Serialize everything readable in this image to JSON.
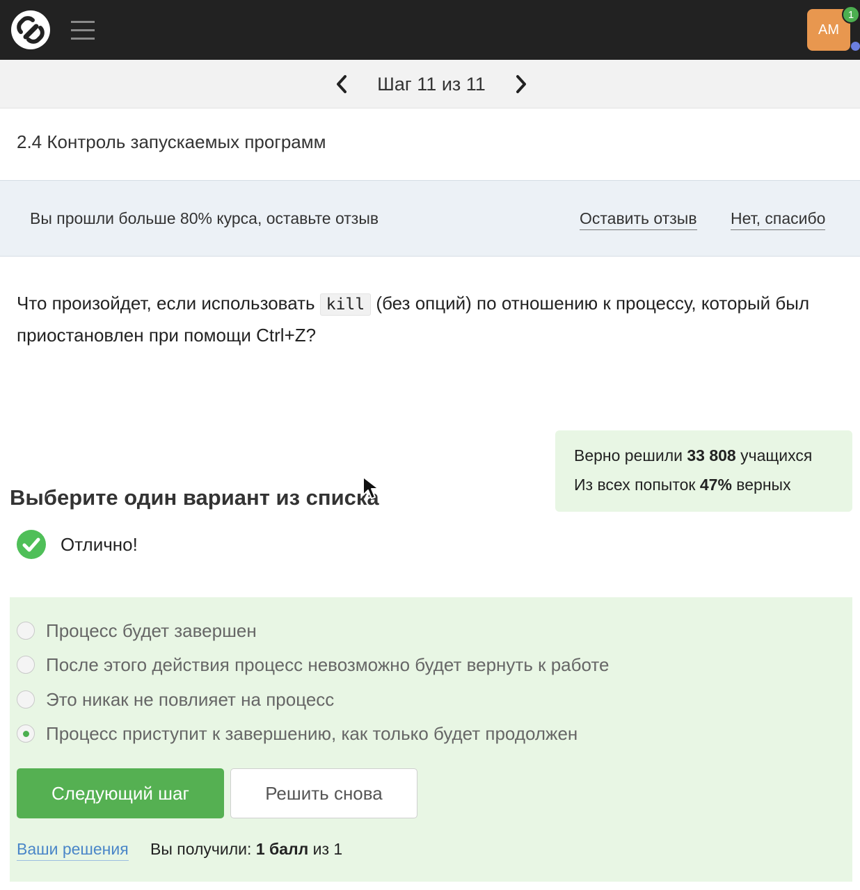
{
  "header": {
    "avatar_initials": "AM",
    "notification_count": "1"
  },
  "step_nav": {
    "label": "Шаг 11 из 11"
  },
  "lesson": {
    "title": "2.4 Контроль запускаемых программ"
  },
  "feedback": {
    "text": "Вы прошли больше 80% курса, оставьте отзыв",
    "leave_review": "Оставить отзыв",
    "no_thanks": "Нет, спасибо"
  },
  "question": {
    "before": "Что произойдет, если использовать",
    "code": "kill",
    "after": "(без опций) по отношению к процессу, который был приостановлен при помощи Ctrl+Z?"
  },
  "stats": {
    "line1_prefix": "Верно решили",
    "line1_value": "33 808",
    "line1_suffix": "учащихся",
    "line2_prefix": "Из всех попыток",
    "line2_value": "47%",
    "line2_suffix": "верных"
  },
  "quiz": {
    "title": "Выберите один вариант из списка",
    "result": "Отлично!",
    "options": [
      {
        "label": "Процесс будет завершен",
        "selected": false
      },
      {
        "label": "После этого действия процесс невозможно будет вернуть к работе",
        "selected": false
      },
      {
        "label": "Это никак не повлияет на процесс",
        "selected": false
      },
      {
        "label": "Процесс приступит к завершению, как только будет продолжен",
        "selected": true
      }
    ],
    "next_button": "Следующий шаг",
    "retry_button": "Решить снова",
    "solutions_link": "Ваши решения",
    "score_prefix": "Вы получили:",
    "score_value": "1 балл",
    "score_suffix": "из 1"
  },
  "colors": {
    "topbar": "#222222",
    "accent_green": "#55b052",
    "avatar": "#e8974f",
    "panel_green": "#e8f6e4",
    "feedback_bg": "#ecf1f6",
    "link_blue": "#4a86c8"
  }
}
